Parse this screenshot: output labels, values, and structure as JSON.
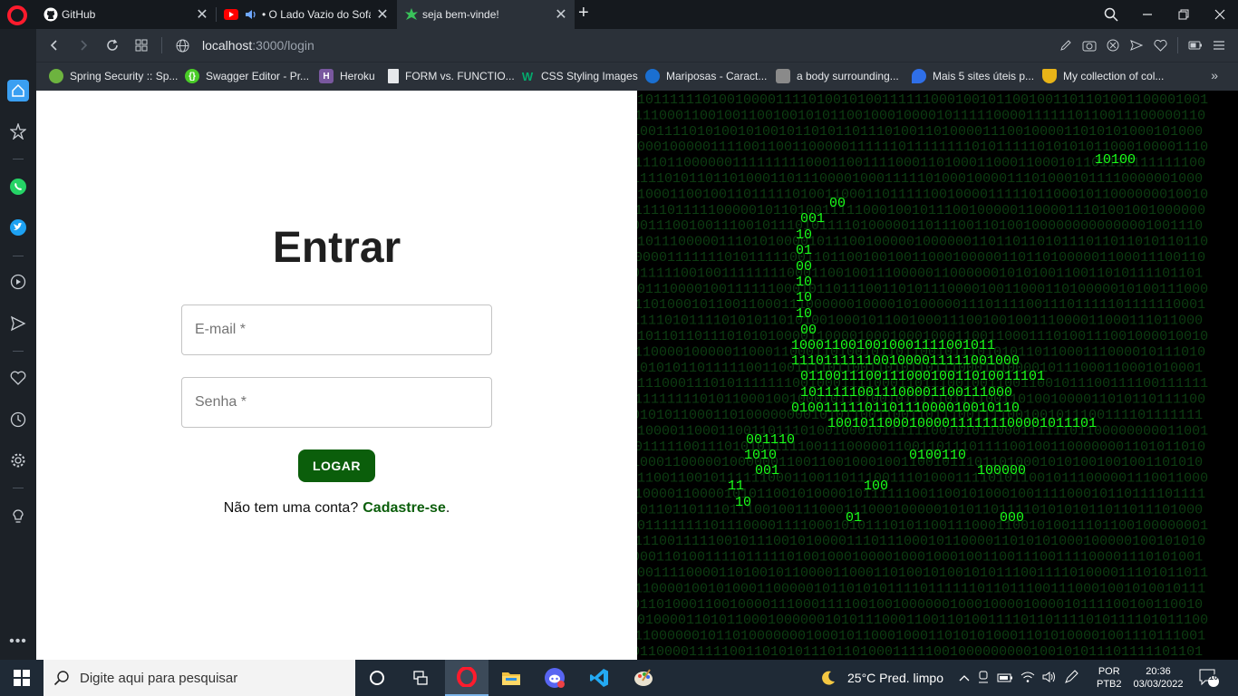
{
  "browser": {
    "tabs": [
      {
        "title": "GitHub",
        "icon": "github-icon"
      },
      {
        "title": "• O Lado Vazio do Sofá",
        "icon": "youtube-icon"
      },
      {
        "title": "seja bem-vinde!",
        "icon": "leaf-icon",
        "active": true
      }
    ],
    "address": {
      "host": "localhost",
      "port_path": ":3000/login"
    },
    "bookmarks": [
      "Spring Security :: Sp...",
      "Swagger Editor - Pr...",
      "Heroku",
      "FORM vs. FUNCTIO...",
      "CSS Styling Images",
      "Mariposas - Caract...",
      "a body surrounding...",
      "Mais 5 sites úteis p...",
      "My collection of col..."
    ]
  },
  "login": {
    "title": "Entrar",
    "email_placeholder": "E-mail *",
    "password_placeholder": "Senha *",
    "button": "LOGAR",
    "signup_text": "Não tem uma conta?",
    "signup_link": "Cadastre-se",
    "signup_suffix": "."
  },
  "taskbar": {
    "search_placeholder": "Digite aqui para pesquisar",
    "weather": "25°C  Pred. limpo",
    "lang_top": "POR",
    "lang_bottom": "PTB2",
    "time": "20:36",
    "date": "03/03/2022",
    "notifications": "10"
  },
  "colors": {
    "accent_green": "#0b5e0b",
    "matrix_green": "#1aff1a"
  }
}
